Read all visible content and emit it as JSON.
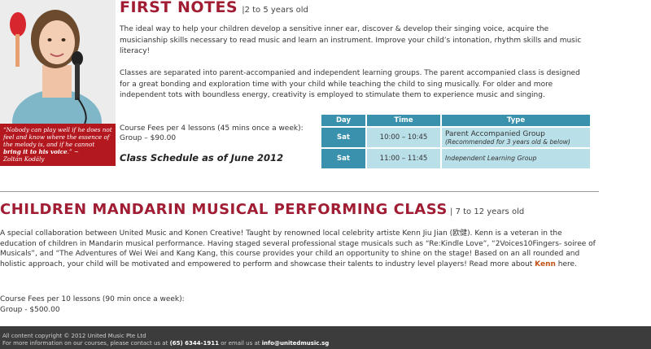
{
  "quote": {
    "part1": "“Nobody can play well if he does not feel and know where the essence of the melody is, and if he cannot ",
    "bold": "bring it to his voice",
    "part2": ".” ~",
    "author": "Zoltán Kodály"
  },
  "first_notes": {
    "title": "FIRST NOTES",
    "age": "|2 to 5 years old",
    "para1": "The ideal way to help your children develop a sensitive inner ear, discover & develop their singing voice, acquire the musicianship skills necessary to read music and learn an instrument. Improve your child’s intonation, rhythm skills and music literacy!",
    "para2": "Classes are separated into parent-accompanied and independent learning groups. The parent accompanied class is designed for a great bonding and exploration time with your child while teaching the child to sing musically. For older and more independent tots with boundless energy, creativity is employed to stimulate them to experience music and singing.",
    "fees_line1": "Course Fees per 4 lessons (45 mins once a week):",
    "fees_line2": "Group – $90.00",
    "schedule_heading": "Class Schedule as of June 2012"
  },
  "schedule": {
    "headers": [
      "Day",
      "Time",
      "Type"
    ],
    "rows": [
      {
        "day": "Sat",
        "time": "10:00 – 10:45",
        "type": "Parent Accompanied Group",
        "note": "(Recommended for 3 years old & below)"
      },
      {
        "day": "Sat",
        "time": "11:00 – 11:45",
        "type": "Independent Learning Group",
        "note": ""
      }
    ]
  },
  "mandarin": {
    "title": "CHILDREN MANDARIN MUSICAL PERFORMING CLASS",
    "age": " | 7 to 12 years old",
    "body_pre": "A special collaboration between United Music and Konen Creative! Taught by renowned local celebrity artiste Kenn Jiu Jian (欧健).  Kenn is a veteran in the education of children in Mandarin musical performance. Having staged several professional stage musicals such as “Re:Kindle Love”, “2Voices10Fingers- soiree of Musicals”, and “The Adventures of Wei Wei and Kang Kang, this course provides your child an opportunity to shine on the stage! Based on an all rounded and holistic approach, your child will be motivated and empowered to perform and showcase their talents to industry level players! Read more about ",
    "body_link": "Kenn",
    "body_post": " here.",
    "fees_line1": "Course Fees per 10 lessons  (90 min once a week):",
    "fees_line2": "Group - $500.00"
  },
  "footer": {
    "line1": "All content copyright © 2012 United Music Pte Ltd",
    "line2_pre": "For more information on our courses, please contact us at ",
    "phone": "(65) 6344-1911",
    "line2_mid": " or email us at ",
    "email": "info@unitedmusic.sg"
  },
  "colors": {
    "title": "#a01d33",
    "quote_bg": "#b3181f",
    "table_header": "#3a91ad",
    "table_cell": "#b9dfe8",
    "link": "#c0531a",
    "footer_bg": "#3c3c3c"
  }
}
